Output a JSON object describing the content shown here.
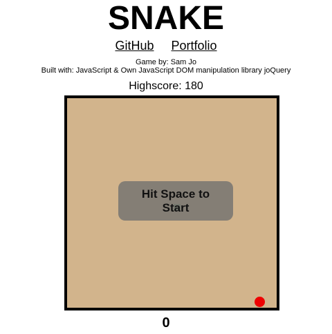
{
  "header": {
    "title": "SNAKE",
    "links": [
      {
        "label": "GitHub"
      },
      {
        "label": "Portfolio"
      }
    ],
    "byline": "Game by: Sam Jo",
    "built_with": "Built with: JavaScript & Own JavaScript DOM manipulation library joQuery"
  },
  "game": {
    "highscore_label": "Highscore: 180",
    "start_prompt": "Hit Space to Start",
    "score": "0",
    "colors": {
      "board": "#d2b48c",
      "border": "#000000",
      "food": "#ee0000",
      "overlay": "#6e6e6e"
    }
  }
}
